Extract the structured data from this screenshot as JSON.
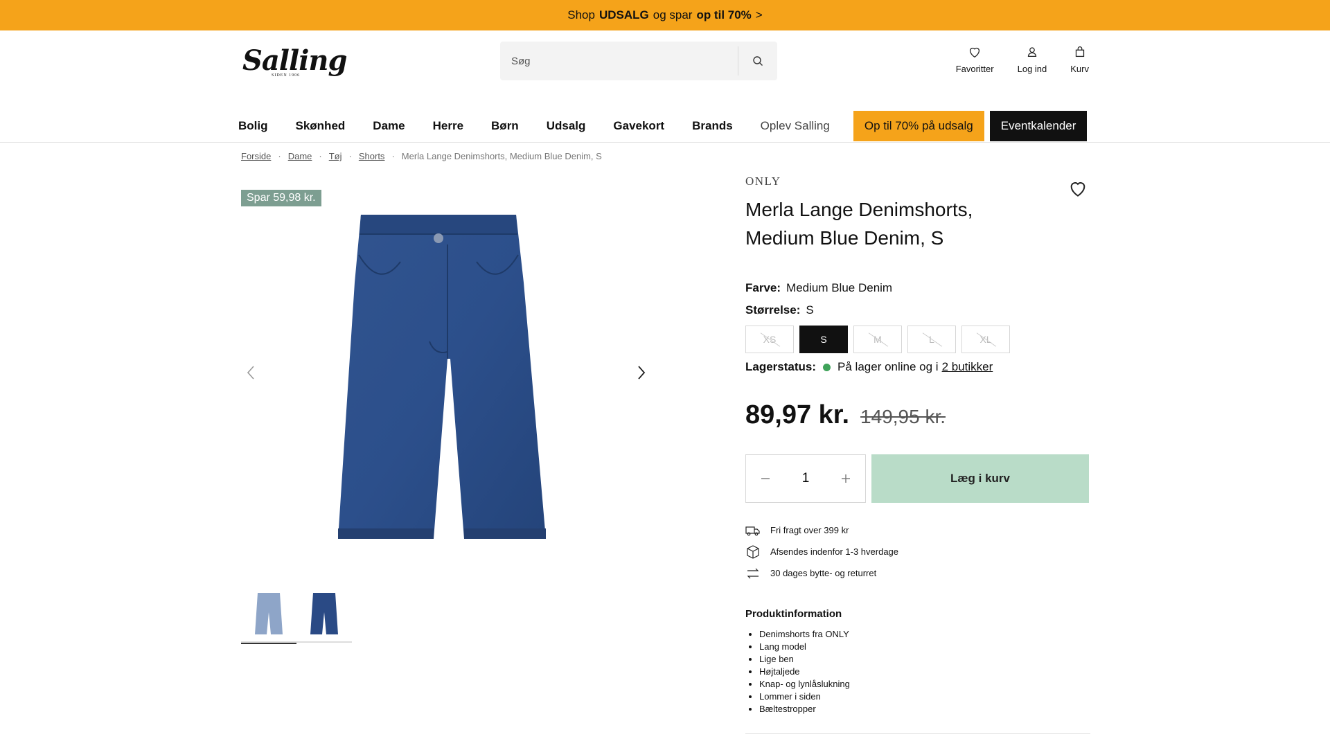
{
  "promo": {
    "text_1": "Shop",
    "text_2": "UDSALG",
    "text_3": "og spar",
    "text_4": "op til 70%",
    "arrow": ">"
  },
  "header": {
    "logo_text": "Salling",
    "logo_sub": "SIDEN 1906",
    "search_placeholder": "Søg",
    "actions": [
      {
        "label": "Favoritter",
        "icon": "heart-icon"
      },
      {
        "label": "Log ind",
        "icon": "user-icon"
      },
      {
        "label": "Kurv",
        "icon": "bag-icon"
      }
    ]
  },
  "nav": {
    "items": [
      "Bolig",
      "Skønhed",
      "Dame",
      "Herre",
      "Børn",
      "Udsalg",
      "Gavekort",
      "Brands"
    ],
    "light_item": "Oplev Salling",
    "sale_button": "Op til 70% på udsalg",
    "event_button": "Eventkalender",
    "colors": {
      "sale": "#f5a31a",
      "event": "#111111"
    }
  },
  "breadcrumb": {
    "items": [
      "Forside",
      "Dame",
      "Tøj",
      "Shorts"
    ],
    "current": "Merla Lange Denimshorts, Medium Blue Denim, S"
  },
  "product": {
    "badge": "Spar 59,98 kr.",
    "brand": "ONLY",
    "title": "Merla Lange Denimshorts, Medium Blue Denim, S",
    "color_label": "Farve:",
    "color_value": "Medium Blue Denim",
    "size_label": "Størrelse:",
    "size_value": "S",
    "sizes": [
      "XS",
      "S",
      "M",
      "L",
      "XL"
    ],
    "stock_label": "Lagerstatus:",
    "stock_text": "På lager online og i",
    "stock_link": "2 butikker",
    "price": "89,97 kr.",
    "old_price": "149,95 kr.",
    "quantity": "1",
    "add_to_cart": "Læg i kurv",
    "perks": [
      {
        "icon": "truck-icon",
        "text": "Fri fragt over 399 kr"
      },
      {
        "icon": "box-icon",
        "text": "Afsendes indenfor 1-3 hverdage"
      },
      {
        "icon": "exchange-icon",
        "text": "30 dages bytte- og returret"
      }
    ],
    "info_title": "Produktinformation",
    "info_items": [
      "Denimshorts fra ONLY",
      "Lang model",
      "Lige ben",
      "Højtaljede",
      "Knap- og lynlåslukning",
      "Lommer i siden",
      "Bæltestropper"
    ],
    "colors": {
      "badge": "#7d9e91",
      "cart_button": "#b9dcc8",
      "stock_dot": "#3fa35a",
      "denim": "#2e4f8a"
    }
  }
}
